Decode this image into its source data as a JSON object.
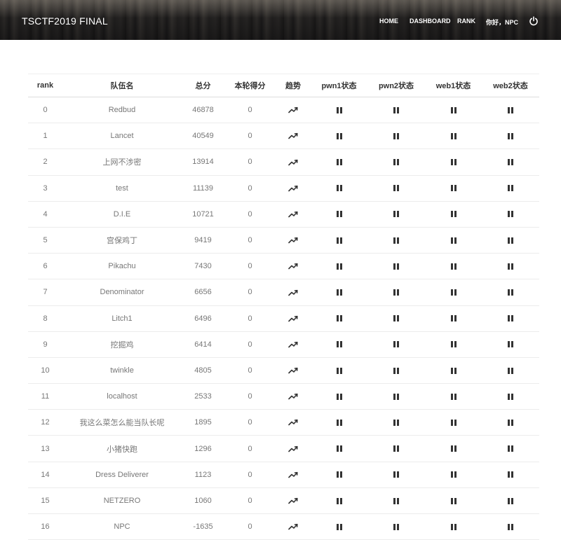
{
  "header": {
    "brand": "TSCTF2019 FINAL",
    "nav": [
      {
        "label": "HOME",
        "name": "nav-home"
      },
      {
        "label": "DASHBOARD",
        "name": "nav-dashboard"
      },
      {
        "label": "RANK",
        "name": "nav-rank"
      },
      {
        "label": "你好，NPC",
        "name": "nav-user-greeting"
      }
    ],
    "logout_icon": "power-icon"
  },
  "table": {
    "columns": [
      "rank",
      "队伍名",
      "总分",
      "本轮得分",
      "趋势",
      "pwn1状态",
      "pwn2状态",
      "web1状态",
      "web2状态"
    ],
    "trend_icon": "trending-up-icon",
    "status_icon": "pause-icon",
    "rows": [
      {
        "rank": "0",
        "team": "Redbud",
        "total": "46878",
        "round": "0"
      },
      {
        "rank": "1",
        "team": "Lancet",
        "total": "40549",
        "round": "0"
      },
      {
        "rank": "2",
        "team": "上网不涉密",
        "total": "13914",
        "round": "0"
      },
      {
        "rank": "3",
        "team": "test",
        "total": "11139",
        "round": "0"
      },
      {
        "rank": "4",
        "team": "D.I.E",
        "total": "10721",
        "round": "0"
      },
      {
        "rank": "5",
        "team": "宫保鸡丁",
        "total": "9419",
        "round": "0"
      },
      {
        "rank": "6",
        "team": "Pikachu",
        "total": "7430",
        "round": "0"
      },
      {
        "rank": "7",
        "team": "Denominator",
        "total": "6656",
        "round": "0"
      },
      {
        "rank": "8",
        "team": "Litch1",
        "total": "6496",
        "round": "0"
      },
      {
        "rank": "9",
        "team": "挖掘鸡",
        "total": "6414",
        "round": "0"
      },
      {
        "rank": "10",
        "team": "twinkle",
        "total": "4805",
        "round": "0"
      },
      {
        "rank": "11",
        "team": "localhost",
        "total": "2533",
        "round": "0"
      },
      {
        "rank": "12",
        "team": "我这么菜怎么能当队长呢",
        "total": "1895",
        "round": "0"
      },
      {
        "rank": "13",
        "team": "小猪快跑",
        "total": "1296",
        "round": "0"
      },
      {
        "rank": "14",
        "team": "Dress Deliverer",
        "total": "1123",
        "round": "0"
      },
      {
        "rank": "15",
        "team": "NETZERO",
        "total": "1060",
        "round": "0"
      },
      {
        "rank": "16",
        "team": "NPC",
        "total": "-1635",
        "round": "0"
      }
    ]
  }
}
